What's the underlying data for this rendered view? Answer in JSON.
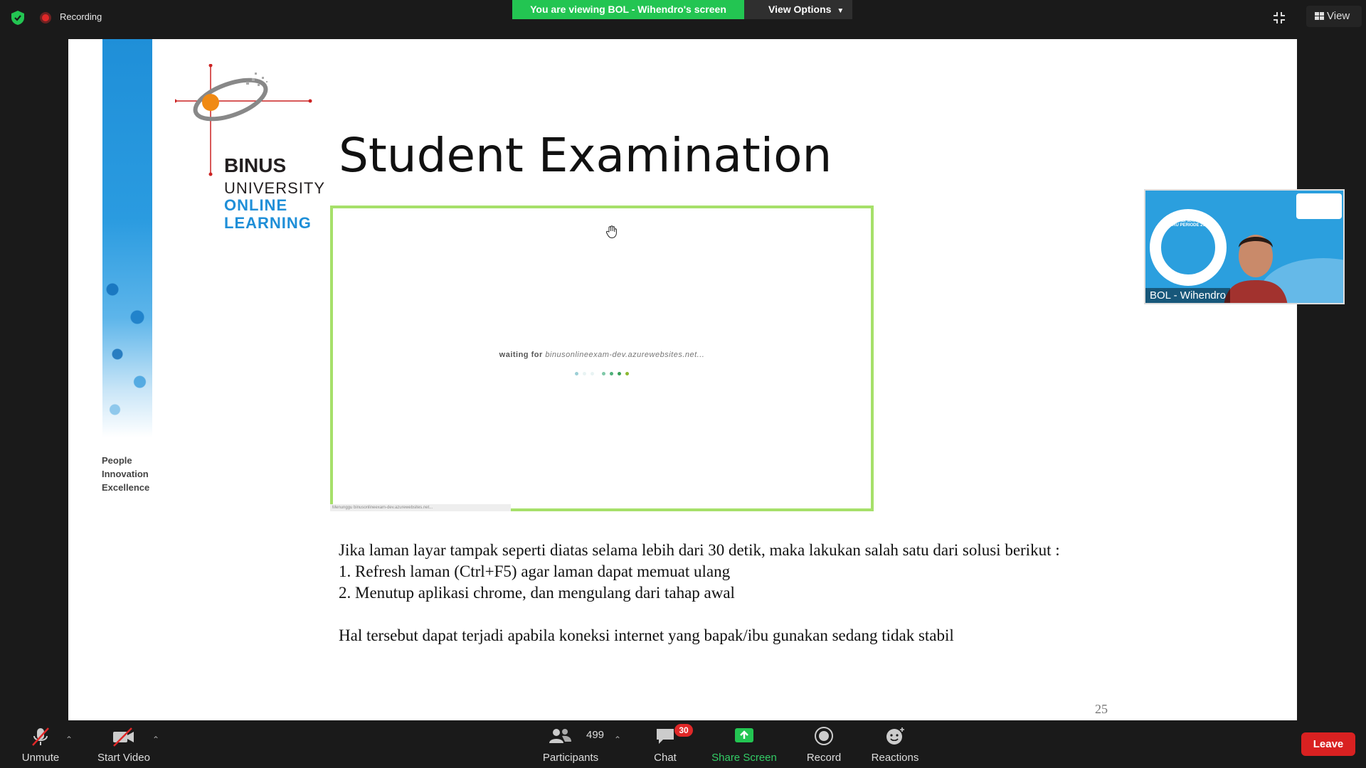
{
  "topbar": {
    "recording_label": "Recording",
    "share_banner": "You are viewing BOL - Wihendro's screen",
    "view_options_label": "View Options",
    "view_label": "View"
  },
  "slide": {
    "tagline": [
      "People",
      "Innovation",
      "Excellence"
    ],
    "logo": {
      "binus": "BINUS",
      "university": "UNIVERSITY",
      "online": "ONLINE",
      "learning": "LEARNING"
    },
    "title": "Student Examination",
    "frame": {
      "waiting_prefix": "waiting for",
      "waiting_host": "binusonlineexam-dev.azurewebsites.net...",
      "status_text": "Menunggu binusonlineexam-dev.azurewebsites.net..."
    },
    "instructions": {
      "line1": "Jika laman layar tampak seperti diatas selama lebih dari 30 detik, maka lakukan salah satu dari solusi berikut :",
      "line2": "1. Refresh laman (Ctrl+F5) agar laman dapat memuat ulang",
      "line3": "2. Menutup aplikasi chrome, dan mengulang dari tahap awal",
      "note": "Hal tersebut dapat terjadi apabila koneksi internet yang bapak/ibu gunakan sedang tidak stabil"
    },
    "page_number": "25"
  },
  "presenter": {
    "name": "BOL - Wihendro",
    "ring_text": "ORIENTASI MAHASISWA BARU PERIODE 2122"
  },
  "toolbar": {
    "unmute_label": "Unmute",
    "start_video_label": "Start Video",
    "participants_label": "Participants",
    "participants_count": "499",
    "chat_label": "Chat",
    "chat_badge": "30",
    "share_screen_label": "Share Screen",
    "record_label": "Record",
    "reactions_label": "Reactions",
    "leave_label": "Leave"
  },
  "colors": {
    "share_banner": "#23c552",
    "frame_border": "#a6e06a",
    "leave": "#d92121",
    "binus_blue": "#1f8fd8"
  }
}
